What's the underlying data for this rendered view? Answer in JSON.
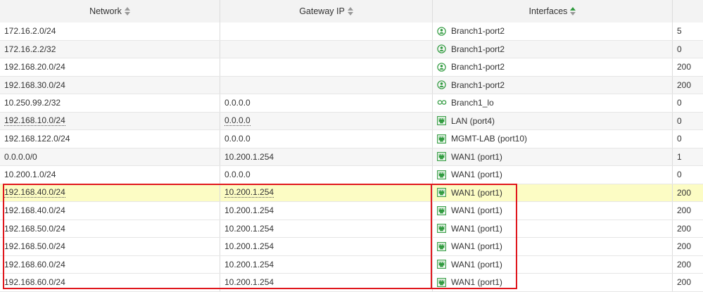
{
  "headers": {
    "network": "Network",
    "gateway": "Gateway IP",
    "interfaces": "Interfaces"
  },
  "rows": [
    {
      "network": "172.16.2.0/24",
      "gateway": "",
      "iface": "Branch1-port2",
      "icon": "user-circle-icon",
      "extra": "5"
    },
    {
      "network": "172.16.2.2/32",
      "gateway": "",
      "iface": "Branch1-port2",
      "icon": "user-circle-icon",
      "extra": "0"
    },
    {
      "network": "192.168.20.0/24",
      "gateway": "",
      "iface": "Branch1-port2",
      "icon": "user-circle-icon",
      "extra": "200"
    },
    {
      "network": "192.168.30.0/24",
      "gateway": "",
      "iface": "Branch1-port2",
      "icon": "user-circle-icon",
      "extra": "200"
    },
    {
      "network": "10.250.99.2/32",
      "gateway": "0.0.0.0",
      "iface": "Branch1_lo",
      "icon": "loopback-icon",
      "extra": "0"
    },
    {
      "network": "192.168.10.0/24",
      "gateway": "0.0.0.0",
      "iface": "LAN (port4)",
      "icon": "ethernet-port-icon",
      "extra": "0"
    },
    {
      "network": "192.168.122.0/24",
      "gateway": "0.0.0.0",
      "iface": "MGMT-LAB (port10)",
      "icon": "ethernet-port-icon",
      "extra": "0"
    },
    {
      "network": "0.0.0.0/0",
      "gateway": "10.200.1.254",
      "iface": "WAN1 (port1)",
      "icon": "ethernet-port-icon",
      "extra": "1"
    },
    {
      "network": "10.200.1.0/24",
      "gateway": "0.0.0.0",
      "iface": "WAN1 (port1)",
      "icon": "ethernet-port-icon",
      "extra": "0"
    },
    {
      "network": "192.168.40.0/24",
      "gateway": "10.200.1.254",
      "iface": "WAN1 (port1)",
      "icon": "ethernet-port-icon",
      "extra": "200"
    },
    {
      "network": "192.168.40.0/24",
      "gateway": "10.200.1.254",
      "iface": "WAN1 (port1)",
      "icon": "ethernet-port-icon",
      "extra": "200"
    },
    {
      "network": "192.168.50.0/24",
      "gateway": "10.200.1.254",
      "iface": "WAN1 (port1)",
      "icon": "ethernet-port-icon",
      "extra": "200"
    },
    {
      "network": "192.168.50.0/24",
      "gateway": "10.200.1.254",
      "iface": "WAN1 (port1)",
      "icon": "ethernet-port-icon",
      "extra": "200"
    },
    {
      "network": "192.168.60.0/24",
      "gateway": "10.200.1.254",
      "iface": "WAN1 (port1)",
      "icon": "ethernet-port-icon",
      "extra": "200"
    },
    {
      "network": "192.168.60.0/24",
      "gateway": "10.200.1.254",
      "iface": "WAN1 (port1)",
      "icon": "ethernet-port-icon",
      "extra": "200"
    }
  ],
  "colors": {
    "highlight_row": "#fcfcc4",
    "annotation_box": "#e0161c",
    "icon_green": "#2f9a3e",
    "sort_active": "#2f9a3e"
  }
}
